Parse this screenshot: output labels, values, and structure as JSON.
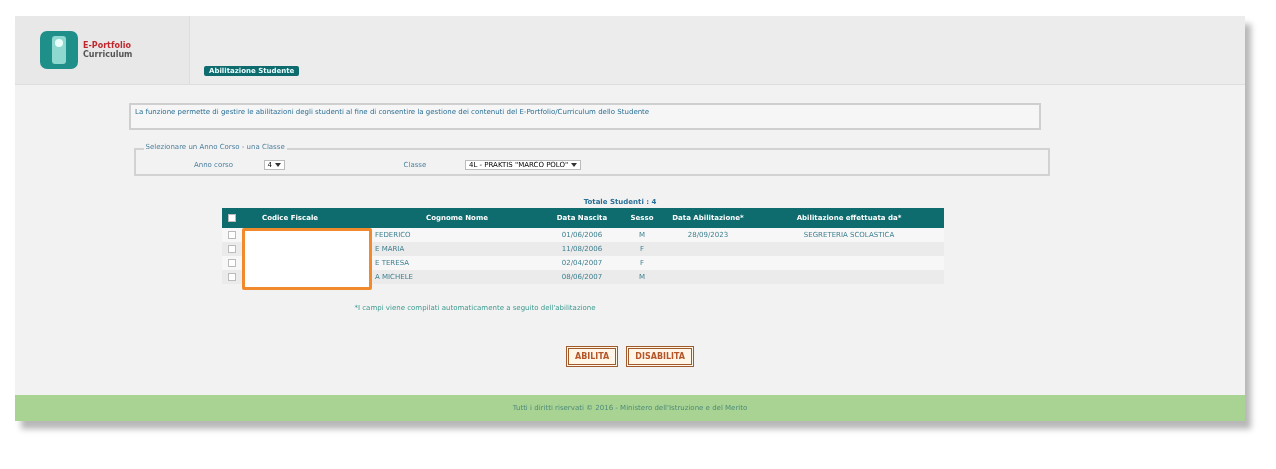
{
  "logo": {
    "line_1": "E-Portfolio",
    "line_2": "Curriculum"
  },
  "tab": {
    "label": "Abilitazione Studente",
    "selected": true
  },
  "info": "La funzione permette di gestire le abilitazioni degli studenti al fine di consentire la gestione dei contenuti del E-Portfolio/Curriculum dello Studente",
  "filter": {
    "legend": "Selezionare un Anno Corso - una Classe",
    "year_label": "Anno corso",
    "year_value": "4",
    "class_label": "Classe",
    "class_value": "4L - PRAKTIS \"MARCO POLO\""
  },
  "total": "Totale Studenti : 4",
  "table": {
    "select_all": {
      "checked": false
    },
    "columns": [
      "Codice Fiscale",
      "Cognome Nome",
      "Data Nascita",
      "Sesso",
      "Data Abilitazione*",
      "Abilitazione effettuata da*"
    ],
    "rows": [
      {
        "checked": false,
        "name": "FEDERICO",
        "birth": "01/06/2006",
        "sex": "M",
        "enabled_on": "28/09/2023",
        "enabled_by": "SEGRETERIA SCOLASTICA"
      },
      {
        "checked": false,
        "name": "E MARIA",
        "birth": "11/08/2006",
        "sex": "F"
      },
      {
        "checked": false,
        "name": "E TERESA",
        "birth": "02/04/2007",
        "sex": "F"
      },
      {
        "checked": false,
        "name": "A MICHELE",
        "birth": "08/06/2007",
        "sex": "M"
      }
    ]
  },
  "note": "*I campi viene compilati automaticamente a seguito dell'abilitazione",
  "buttons": [
    "ABILITA",
    "DISABILITA"
  ],
  "footer": "Tutti i diritti riservati © 2016 - Ministero dell'Istruzione e del Merito"
}
